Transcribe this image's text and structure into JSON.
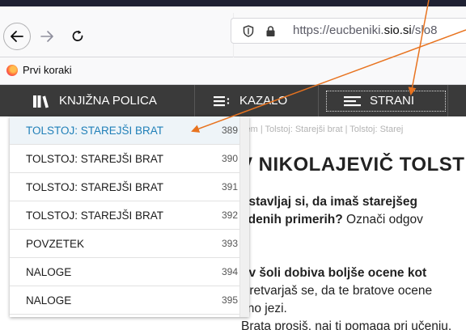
{
  "browser": {
    "url": {
      "prefix": "https://eucbeniki.",
      "domain": "sio.si",
      "suffix": "/slo8"
    },
    "bookmarks": [
      {
        "label": "Prvi koraki"
      }
    ]
  },
  "toolbar": {
    "shelf_label": "KNJIŽNA POLICA",
    "index_label": "KAZALO",
    "pages_label": "STRANI"
  },
  "dropdown": {
    "items": [
      {
        "label": "TOLSTOJ: STAREJŠI BRAT",
        "page": "389",
        "active": true
      },
      {
        "label": "TOLSTOJ: STAREJŠI BRAT",
        "page": "390"
      },
      {
        "label": "TOLSTOJ: STAREJŠI BRAT",
        "page": "391"
      },
      {
        "label": "TOLSTOJ: STAREJŠI BRAT",
        "page": "392"
      },
      {
        "label": "POVZETEK",
        "page": "393"
      },
      {
        "label": "NALOGE",
        "page": "394"
      },
      {
        "label": "NALOGE",
        "page": "395"
      }
    ]
  },
  "content": {
    "breadcrumb": "zem | Tolstoj: Starejši brat | Tolstoj: Starej",
    "heading": "V NIKOLAJEVIČ TOLST",
    "para1_line1": "dstavljaj si, da imaš starejšeg",
    "para1_line2_bold": "edenih primerih?",
    "para1_line2_rest": " Označi odgov",
    "para2_bold": "t v šoli dobiva boljše ocene kot",
    "para2_line2": "Pretvarjaš se, da te bratove ocene",
    "para2_line3": "čno jezi.",
    "para2_line4": "Brata prosiš, naj ti pomaga pri učenju."
  },
  "colors": {
    "annotation_arrow": "#e8731f",
    "active_item": "#1f7fb8",
    "toolbar_bg": "#3a3a3a"
  }
}
